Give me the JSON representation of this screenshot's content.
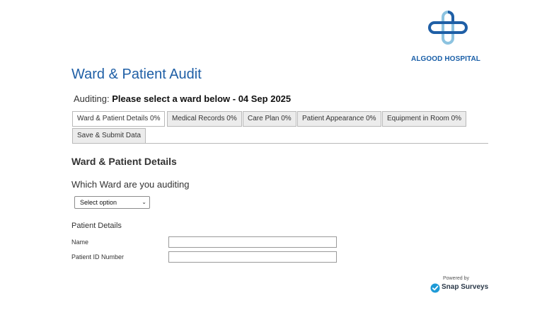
{
  "brand": {
    "name": "ALGOOD HOSPITAL",
    "logo_icon": "medical-cross-logo",
    "primary_color": "#1f5fa6",
    "light_color": "#8cc3e0"
  },
  "page": {
    "title": "Ward & Patient Audit",
    "auditing_prefix": "Auditing:",
    "auditing_value": "Please select a ward below - 04 Sep 2025"
  },
  "tabs": [
    {
      "label": "Ward & Patient Details 0%",
      "active": true
    },
    {
      "label": "Medical Records 0%",
      "active": false
    },
    {
      "label": "Care Plan 0%",
      "active": false
    },
    {
      "label": "Patient Appearance 0%",
      "active": false
    },
    {
      "label": "Equipment in Room 0%",
      "active": false
    },
    {
      "label": "Save & Submit Data",
      "active": false
    }
  ],
  "section": {
    "title": "Ward & Patient Details",
    "question": "Which Ward are you auditing",
    "ward_select": {
      "selected": "Select option"
    },
    "patient_details_label": "Patient Details",
    "fields": [
      {
        "label": "Name",
        "value": ""
      },
      {
        "label": "Patient ID Number",
        "value": ""
      }
    ]
  },
  "footer": {
    "powered_by": "Powered by",
    "vendor": "Snap Surveys",
    "vendor_icon": "snap-check-icon"
  }
}
